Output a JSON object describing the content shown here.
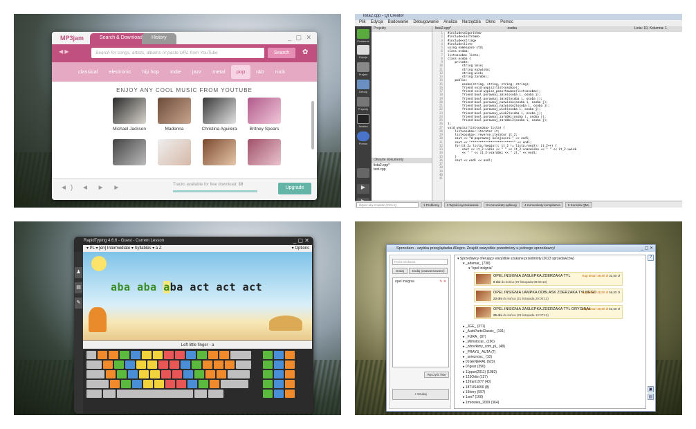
{
  "mp3jam": {
    "logo": "MP3jam",
    "tabs": [
      "Search & Downloads",
      "History"
    ],
    "window_controls": "_ ▢ ✕",
    "search_placeholder": "Search for songs, artists, albums or paste URL from YouTube",
    "search_button": "Search",
    "genres": [
      "classical",
      "electronic",
      "hip hop",
      "indie",
      "jazz",
      "metal",
      "pop",
      "r&b",
      "rock"
    ],
    "selected_genre": "pop",
    "heading": "ENJOY ANY COOL MUSIC FROM YOUTUBE",
    "artists": [
      "Michael Jackson",
      "Madonna",
      "Christina Aguilera",
      "Britney Spears"
    ],
    "info_text": "Tracks available for free download:",
    "info_count": "30",
    "upgrade": "Upgrade",
    "accent": "#c0517f"
  },
  "qtcreator": {
    "title": "lista2.cpp - Qt Creator",
    "menu": [
      "Plik",
      "Edycja",
      "Budowanie",
      "Debugowanie",
      "Analiza",
      "Narzędzia",
      "Okno",
      "Pomoc"
    ],
    "sidebar": [
      "Powitanie",
      "Edycja",
      "Projekt",
      "Debug",
      "Projekty",
      "Analiza",
      "Pomoc"
    ],
    "projects_header": "Projekty",
    "open_docs_header": "Otwarte dokumenty",
    "open_docs": [
      "lista2.cpp*",
      "test.cpp"
    ],
    "editor_file": "lista2.cpp*",
    "editor_symbol": "osoba",
    "position": "Linia: 10, Kolumna: 1",
    "status_tabs": [
      "1 Problemy",
      "2 Wyniki wyszukiwania",
      "3 Komunikaty aplikacji",
      "4 Komunikaty kompilatora",
      "5 Konsola QML"
    ],
    "locator": "Wpisz aby znaleźć (Ctrl+K)",
    "code": [
      "#include<algorithm>",
      "#include<iostream>",
      "#include<string>",
      "#include<list>",
      "",
      "using namespace std;",
      "",
      "class osoba;",
      "list<osoba> lista;",
      "class osoba {",
      "    private:",
      "        string imie;",
      "        string nazwisko;",
      "        string wiek;",
      "        string zarobki;",
      "    public:",
      "        osoba(string, string, string, string);",
      "        friend void wypisz(list<osoba>);",
      "        friend void wypisz_posortowane(list<osoba>);",
      "        friend bool porownaj_imie(osoba i, osoba j);",
      "        friend bool porownaj_imie2(osoba i, osoba j);",
      "        friend bool porownaj_nazwisko(osoba i, osoba j);",
      "        friend bool porownaj_nazwisko2(osoba i, osoba j);",
      "        friend bool porownaj_wiek(osoba i, osoba j);",
      "        friend bool porownaj_wiek2(osoba i, osoba j);",
      "        friend bool porownaj_zarobki(osoba i, osoba j);",
      "        friend bool porownaj_zarobki2(osoba i, osoba j);",
      "};",
      "",
      "void wypisz(list<osoba> lista) {",
      "    list<osoba>::iterator it;",
      "    list<osoba>::reverse_iterator it_2;",
      "",
      "    cout << \"W poprawnej kolejnosci:\" << endl;",
      "    cout << \"************************\" << endl;",
      "    for(it_2= lista.rbegin(); it_2 != lista.rend(); it_2++) {",
      "        cout << it_2->imie << \" \" << it_2->nazwisko << \" \" << it_2->wiek",
      "        << \" \" << it_2->zarobki << \" zl.\" << endl;",
      "    }",
      "",
      "    cout << endl << endl;"
    ]
  },
  "rapidtyping": {
    "title": "RapidTyping 4.6.6 - Guest - Current Lesson",
    "toolbar": "▾ PL  ▾ [en] Intermediate  ▾ Syllables  ▾ a  Z",
    "options": "▾ Options",
    "text_done": "aba aba ",
    "text_cur": "a",
    "text_rest": "ba act act act",
    "hint": "Left little finger - a"
  },
  "sprzedam": {
    "title": "Sprzedam - szybka przeglądarka Allegro. Znajdź wszystkie przedmioty u jednego sprzedawcy!",
    "input_placeholder": "Fraza szukania",
    "btn_add": "Dodaj",
    "btn_add_adv": "Dodaj (zaawansowane)",
    "query": "opel insignia",
    "btn_clear": "Wyczyść listę",
    "btn_search": "Szukaj",
    "tree_root": "Sprzedawcy oferujący wszystkie szukane przedmioty (2023 sprzedawców)",
    "seller": "_adamar_ (738)",
    "seller_query": "\"opel insignia\"",
    "offers": [
      {
        "title": "OPEL INSIGNIA ZASLEPKA ZDERZAKA TYL",
        "days": "9 dni",
        "date": "do końca (07 listopada 08:03:13)",
        "price": "Kup teraz! 39,00 zł",
        "price2": "32,50 zł"
      },
      {
        "title": "OPEL INSIGNIA LAMPKA ODBLASK ZDERZAKA TYLNEGO",
        "days": "23 dni",
        "date": "do końca (21 listopada 20:00:13)",
        "price": "Kup teraz! 45,00 zł",
        "price2": "56,00 zł"
      },
      {
        "title": "OPEL INSIGNIA ZASLEPKA ZDERZAKA TYL ORYGINAŁ",
        "days": "25 dni",
        "date": "do końca (23 listopada 12:07:13)",
        "price": "Kup teraz! 30,00 zł",
        "price2": "52,50 zł"
      }
    ],
    "sellers": [
      "_JGE_ (371)",
      "_AutoPartsClassic_ (191)",
      "_FURA_ (87)",
      "_Mimotocar_ (190)",
      "_zdrsvkimy_com_pl_ (48)",
      "_PRAYS_ AUTA (7)",
      "_snieznosc_ (10)",
      "01GENERAL (623)",
      "07gear (396)",
      "11ppor(2011) (1083)",
      "123Ortis (127)",
      "13frani1977 (43)",
      "18TUS4656 (8)",
      "19lorry (597)",
      "1sm7 (160)",
      "1mrowies_2009 (364)"
    ]
  }
}
